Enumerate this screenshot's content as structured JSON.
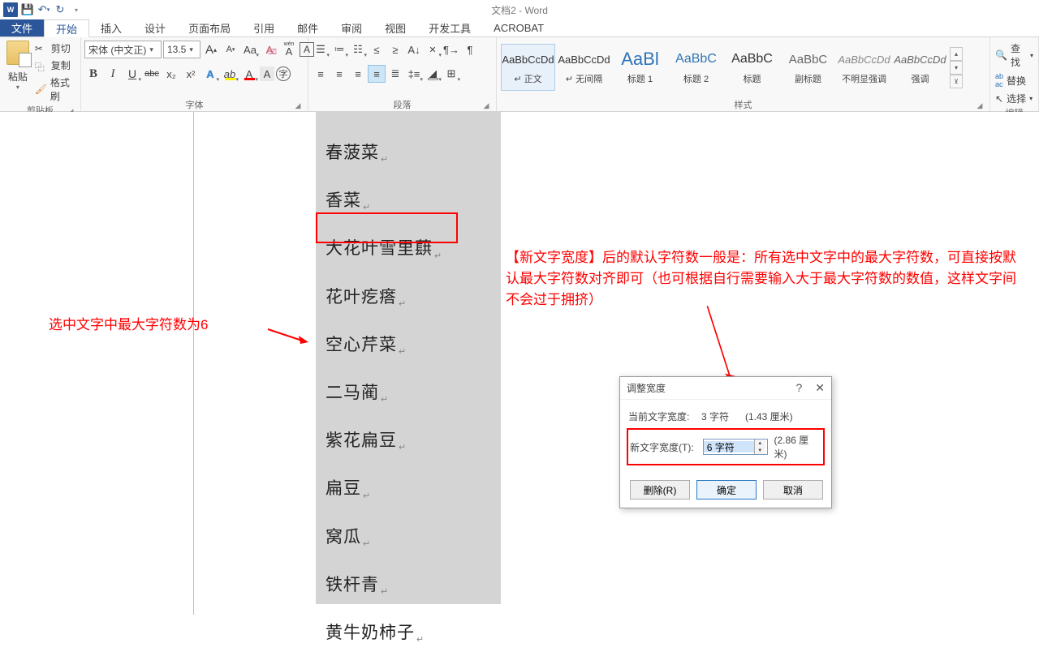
{
  "titlebar": {
    "title": "文档2 - Word",
    "word_icon_text": "W"
  },
  "tabs": {
    "file": "文件",
    "home": "开始",
    "insert": "插入",
    "design": "设计",
    "layout": "页面布局",
    "references": "引用",
    "mailings": "邮件",
    "review": "审阅",
    "view": "视图",
    "developer": "开发工具",
    "acrobat": "ACROBAT"
  },
  "clipboard": {
    "paste_label": "粘贴",
    "cut": "剪切",
    "copy": "复制",
    "formatpainter": "格式刷",
    "group_label": "剪贴板"
  },
  "font": {
    "family": "宋体 (中文正)",
    "size": "13.5",
    "group_label": "字体",
    "grow": "A",
    "shrink": "A",
    "case": "Aa",
    "clear": "A",
    "bold": "B",
    "italic": "I",
    "underline": "U",
    "strike": "abc",
    "sub": "x₂",
    "sup": "x²",
    "teffect": "A",
    "highlight": "A",
    "color": "A",
    "char_shading": "A",
    "circled": "字"
  },
  "paragraph": {
    "group_label": "段落"
  },
  "styles": {
    "group_label": "样式",
    "items": [
      {
        "preview": "AaBbCcDd",
        "name": "↵ 正文"
      },
      {
        "preview": "AaBbCcDd",
        "name": "↵ 无间隔"
      },
      {
        "preview": "AaBl",
        "name": "标题 1"
      },
      {
        "preview": "AaBbC",
        "name": "标题 2"
      },
      {
        "preview": "AaBbC",
        "name": "标题"
      },
      {
        "preview": "AaBbC",
        "name": "副标题"
      },
      {
        "preview": "AaBbCcDd",
        "name": "不明显强调"
      },
      {
        "preview": "AaBbCcDd",
        "name": "强调"
      }
    ]
  },
  "editing": {
    "find": "查找",
    "replace": "替换",
    "select": "选择",
    "group_label": "编辑"
  },
  "content": {
    "lines": [
      "春菠菜",
      "香菜",
      "大花叶雪里蕻",
      "花叶疙瘩",
      "空心芹菜",
      "二马蔺",
      "紫花扁豆",
      "扁豆",
      "窝瓜",
      "铁杆青",
      "黄牛奶柿子"
    ]
  },
  "anno": {
    "left_text": "选中文字中最大字符数为6",
    "right_text": "【新文字宽度】后的默认字符数一般是：所有选中文字中的最大字符数，可直接按默认最大字符数对齐即可（也可根据自行需要输入大于最大字符数的数值，这样文字间不会过于拥挤）"
  },
  "dialog": {
    "title": "调整宽度",
    "cur_label": "当前文字宽度:",
    "cur_val": "3 字符",
    "cur_cm": "(1.43 厘米)",
    "new_label": "新文字宽度(T):",
    "new_val": "6 字符",
    "new_cm": "(2.86 厘米)",
    "delete": "删除(R)",
    "ok": "确定",
    "cancel": "取消",
    "help": "?",
    "close": "✕"
  }
}
